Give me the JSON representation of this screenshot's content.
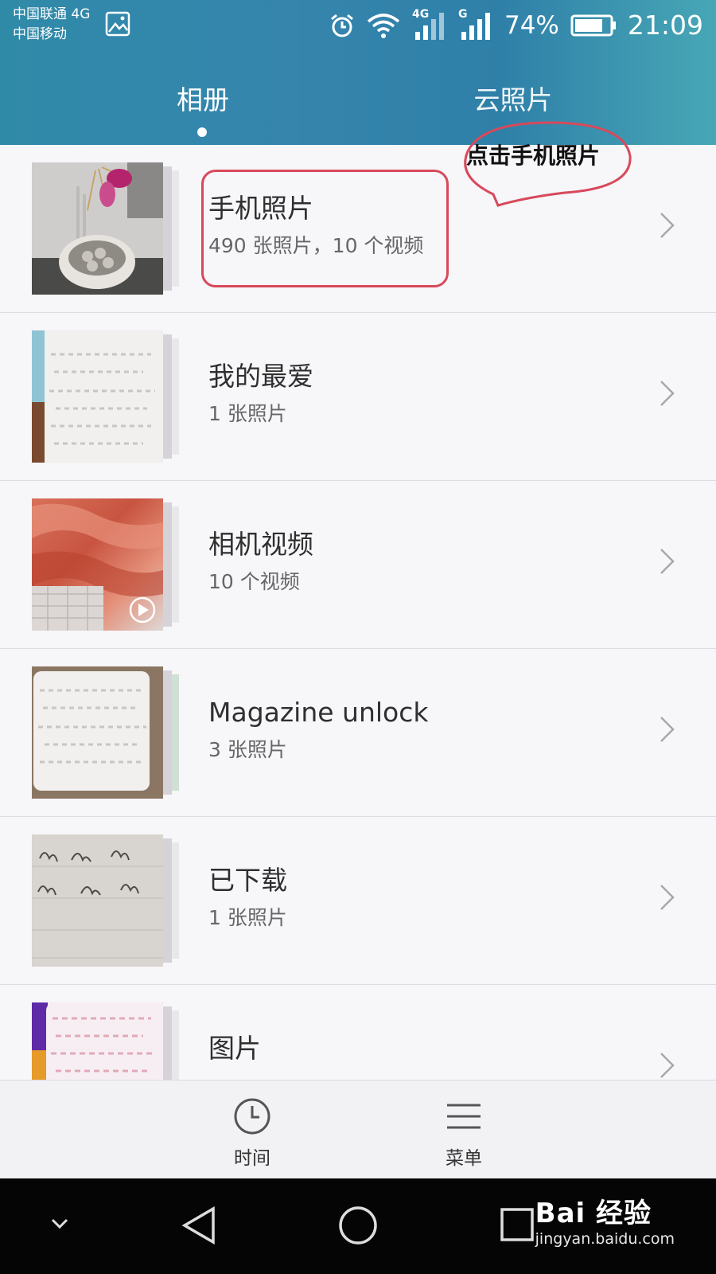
{
  "status_bar": {
    "carrier_1": "中国联通 4G",
    "carrier_2": "中国移动",
    "signal_1_tag": "4G",
    "signal_2_tag": "G",
    "battery": "74%",
    "time": "21:09"
  },
  "tabs": [
    {
      "label": "相册",
      "selected": true
    },
    {
      "label": "云照片",
      "selected": false
    }
  ],
  "albums": [
    {
      "title": "手机照片",
      "subtitle": "490 张照片，10 个视频"
    },
    {
      "title": "我的最爱",
      "subtitle": "1 张照片"
    },
    {
      "title": "相机视频",
      "subtitle": "10 个视频"
    },
    {
      "title": "Magazine unlock",
      "subtitle": "3 张照片"
    },
    {
      "title": "已下载",
      "subtitle": "1 张照片"
    },
    {
      "title": "图片",
      "subtitle": ""
    }
  ],
  "annotation": {
    "text": "点击手机照片",
    "color": "#d8495b"
  },
  "bottom_bar": {
    "time_label": "时间",
    "menu_label": "菜单"
  },
  "watermark": {
    "main": "Bai 经验",
    "sub": "jingyan.baidu.com"
  },
  "colors": {
    "header": "#3585ad",
    "background": "#f7f6f9",
    "nav": "#050505"
  }
}
